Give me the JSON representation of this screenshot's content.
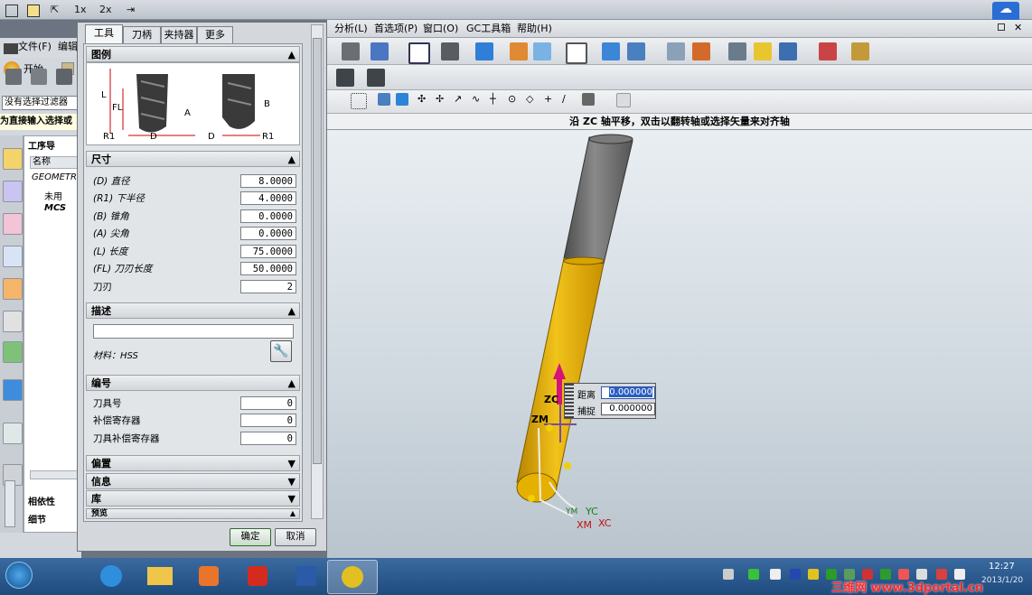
{
  "top_strip": {
    "zoom1": "1x",
    "zoom2": "2x"
  },
  "left_menu": {
    "file": "文件(F)",
    "edit": "编辑",
    "start": "开始",
    "filter": "没有选择过滤器",
    "hint": "为直接输入选择或",
    "navigator_title": "工序导",
    "col_name": "名称",
    "tree_root": "GEOMETR",
    "tree_unused": "未用",
    "tree_mcs": "MCS",
    "dependency": "相依性",
    "detail": "细节"
  },
  "menubar": {
    "items": [
      "分析(L)",
      "首选项(P)",
      "窗口(O)",
      "GC工具箱",
      "帮助(H)"
    ]
  },
  "status_message": "沿 ZC 轴平移，双击以翻转轴或选择矢量来对齐轴",
  "dialog": {
    "tabs": [
      "工具",
      "刀柄",
      "夹持器",
      "更多"
    ],
    "sections": {
      "legend": "图例",
      "dimensions": "尺寸",
      "description": "描述",
      "numbering": "编号",
      "offset": "偏置",
      "info": "信息",
      "library": "库",
      "preview": "预览"
    },
    "legend_labels": {
      "L": "L",
      "FL": "FL",
      "R1": "R1",
      "D": "D",
      "A": "A",
      "B": "B"
    },
    "params": [
      {
        "label": "(D) 直径",
        "value": "8.0000"
      },
      {
        "label": "(R1) 下半径",
        "value": "4.0000"
      },
      {
        "label": "(B) 锥角",
        "value": "0.0000"
      },
      {
        "label": "(A) 尖角",
        "value": "0.0000"
      },
      {
        "label": "(L) 长度",
        "value": "75.0000"
      },
      {
        "label": "(FL) 刀刃长度",
        "value": "50.0000"
      },
      {
        "label": "刀刃",
        "value": "2"
      }
    ],
    "description_value": "",
    "material": "材料：HSS",
    "numbering": [
      {
        "label": "刀具号",
        "value": "0"
      },
      {
        "label": "补偿寄存器",
        "value": "0"
      },
      {
        "label": "刀具补偿寄存器",
        "value": "0"
      }
    ],
    "ok": "确定",
    "cancel": "取消"
  },
  "viewport": {
    "distance_label": "距离",
    "distance_value": "0.000000",
    "snap_label": "捕捉",
    "snap_value": "0.000000",
    "axis_zc": "ZC",
    "axis_zm": "ZM",
    "axis_yc": "YC",
    "axis_xc": "XC",
    "axis_xm": "XM",
    "axis_ym": "YM",
    "colors": {
      "tool_gold": "#e9b400",
      "shank_gray": "#6d6d6d",
      "arrow_magenta": "#d4147a"
    }
  },
  "taskbar": {
    "time": "12:27",
    "date": "2013/1/20",
    "watermark": "三维网 www.3dportal.cn"
  }
}
